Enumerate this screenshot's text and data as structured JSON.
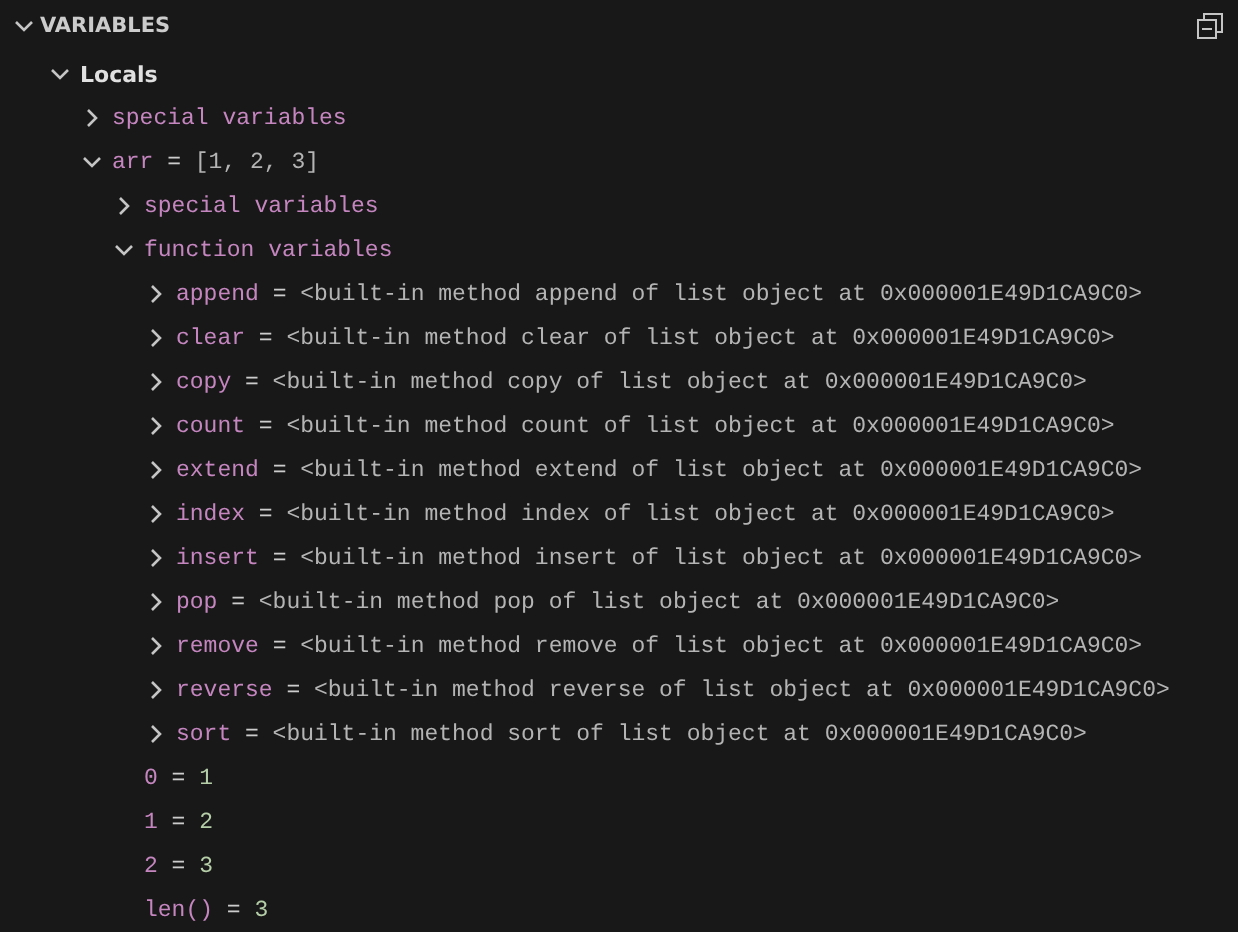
{
  "section": {
    "title": "VARIABLES",
    "expanded": true
  },
  "tree": [
    {
      "kind": "scope",
      "name": "Locals",
      "expanded": true,
      "children": [
        {
          "kind": "group",
          "name": "special variables",
          "expanded": false
        },
        {
          "kind": "variable",
          "name": "arr",
          "separator": "=",
          "value": "[1, 2, 3]",
          "color": "#b4b4b4",
          "expanded": true,
          "children": [
            {
              "kind": "group",
              "name": "special variables",
              "expanded": false
            },
            {
              "kind": "group",
              "name": "function variables",
              "expanded": true,
              "children": [
                {
                  "kind": "variable",
                  "name": "append",
                  "separator": "=",
                  "value": "<built-in method append of list object at 0x000001E49D1CA9C0>",
                  "color": "#b4b4b4",
                  "expanded": false
                },
                {
                  "kind": "variable",
                  "name": "clear",
                  "separator": "=",
                  "value": "<built-in method clear of list object at 0x000001E49D1CA9C0>",
                  "color": "#b4b4b4",
                  "expanded": false
                },
                {
                  "kind": "variable",
                  "name": "copy",
                  "separator": "=",
                  "value": "<built-in method copy of list object at 0x000001E49D1CA9C0>",
                  "color": "#b4b4b4",
                  "expanded": false
                },
                {
                  "kind": "variable",
                  "name": "count",
                  "separator": "=",
                  "value": "<built-in method count of list object at 0x000001E49D1CA9C0>",
                  "color": "#b4b4b4",
                  "expanded": false
                },
                {
                  "kind": "variable",
                  "name": "extend",
                  "separator": "=",
                  "value": "<built-in method extend of list object at 0x000001E49D1CA9C0>",
                  "color": "#b4b4b4",
                  "expanded": false
                },
                {
                  "kind": "variable",
                  "name": "index",
                  "separator": "=",
                  "value": "<built-in method index of list object at 0x000001E49D1CA9C0>",
                  "color": "#b4b4b4",
                  "expanded": false
                },
                {
                  "kind": "variable",
                  "name": "insert",
                  "separator": "=",
                  "value": "<built-in method insert of list object at 0x000001E49D1CA9C0>",
                  "color": "#b4b4b4",
                  "expanded": false
                },
                {
                  "kind": "variable",
                  "name": "pop",
                  "separator": "=",
                  "value": "<built-in method pop of list object at 0x000001E49D1CA9C0>",
                  "color": "#b4b4b4",
                  "expanded": false
                },
                {
                  "kind": "variable",
                  "name": "remove",
                  "separator": "=",
                  "value": "<built-in method remove of list object at 0x000001E49D1CA9C0>",
                  "color": "#b4b4b4",
                  "expanded": false
                },
                {
                  "kind": "variable",
                  "name": "reverse",
                  "separator": "=",
                  "value": "<built-in method reverse of list object at 0x000001E49D1CA9C0>",
                  "color": "#b4b4b4",
                  "expanded": false
                },
                {
                  "kind": "variable",
                  "name": "sort",
                  "separator": "=",
                  "value": "<built-in method sort of list object at 0x000001E49D1CA9C0>",
                  "color": "#b4b4b4",
                  "expanded": false
                }
              ]
            },
            {
              "kind": "leaf",
              "name": "0",
              "separator": "=",
              "value": "1",
              "color": "#b5cea8"
            },
            {
              "kind": "leaf",
              "name": "1",
              "separator": "=",
              "value": "2",
              "color": "#b5cea8"
            },
            {
              "kind": "leaf",
              "name": "2",
              "separator": "=",
              "value": "3",
              "color": "#b5cea8"
            },
            {
              "kind": "leaf",
              "name": "len()",
              "separator": "=",
              "value": "3",
              "color": "#b5cea8"
            }
          ]
        }
      ]
    }
  ]
}
